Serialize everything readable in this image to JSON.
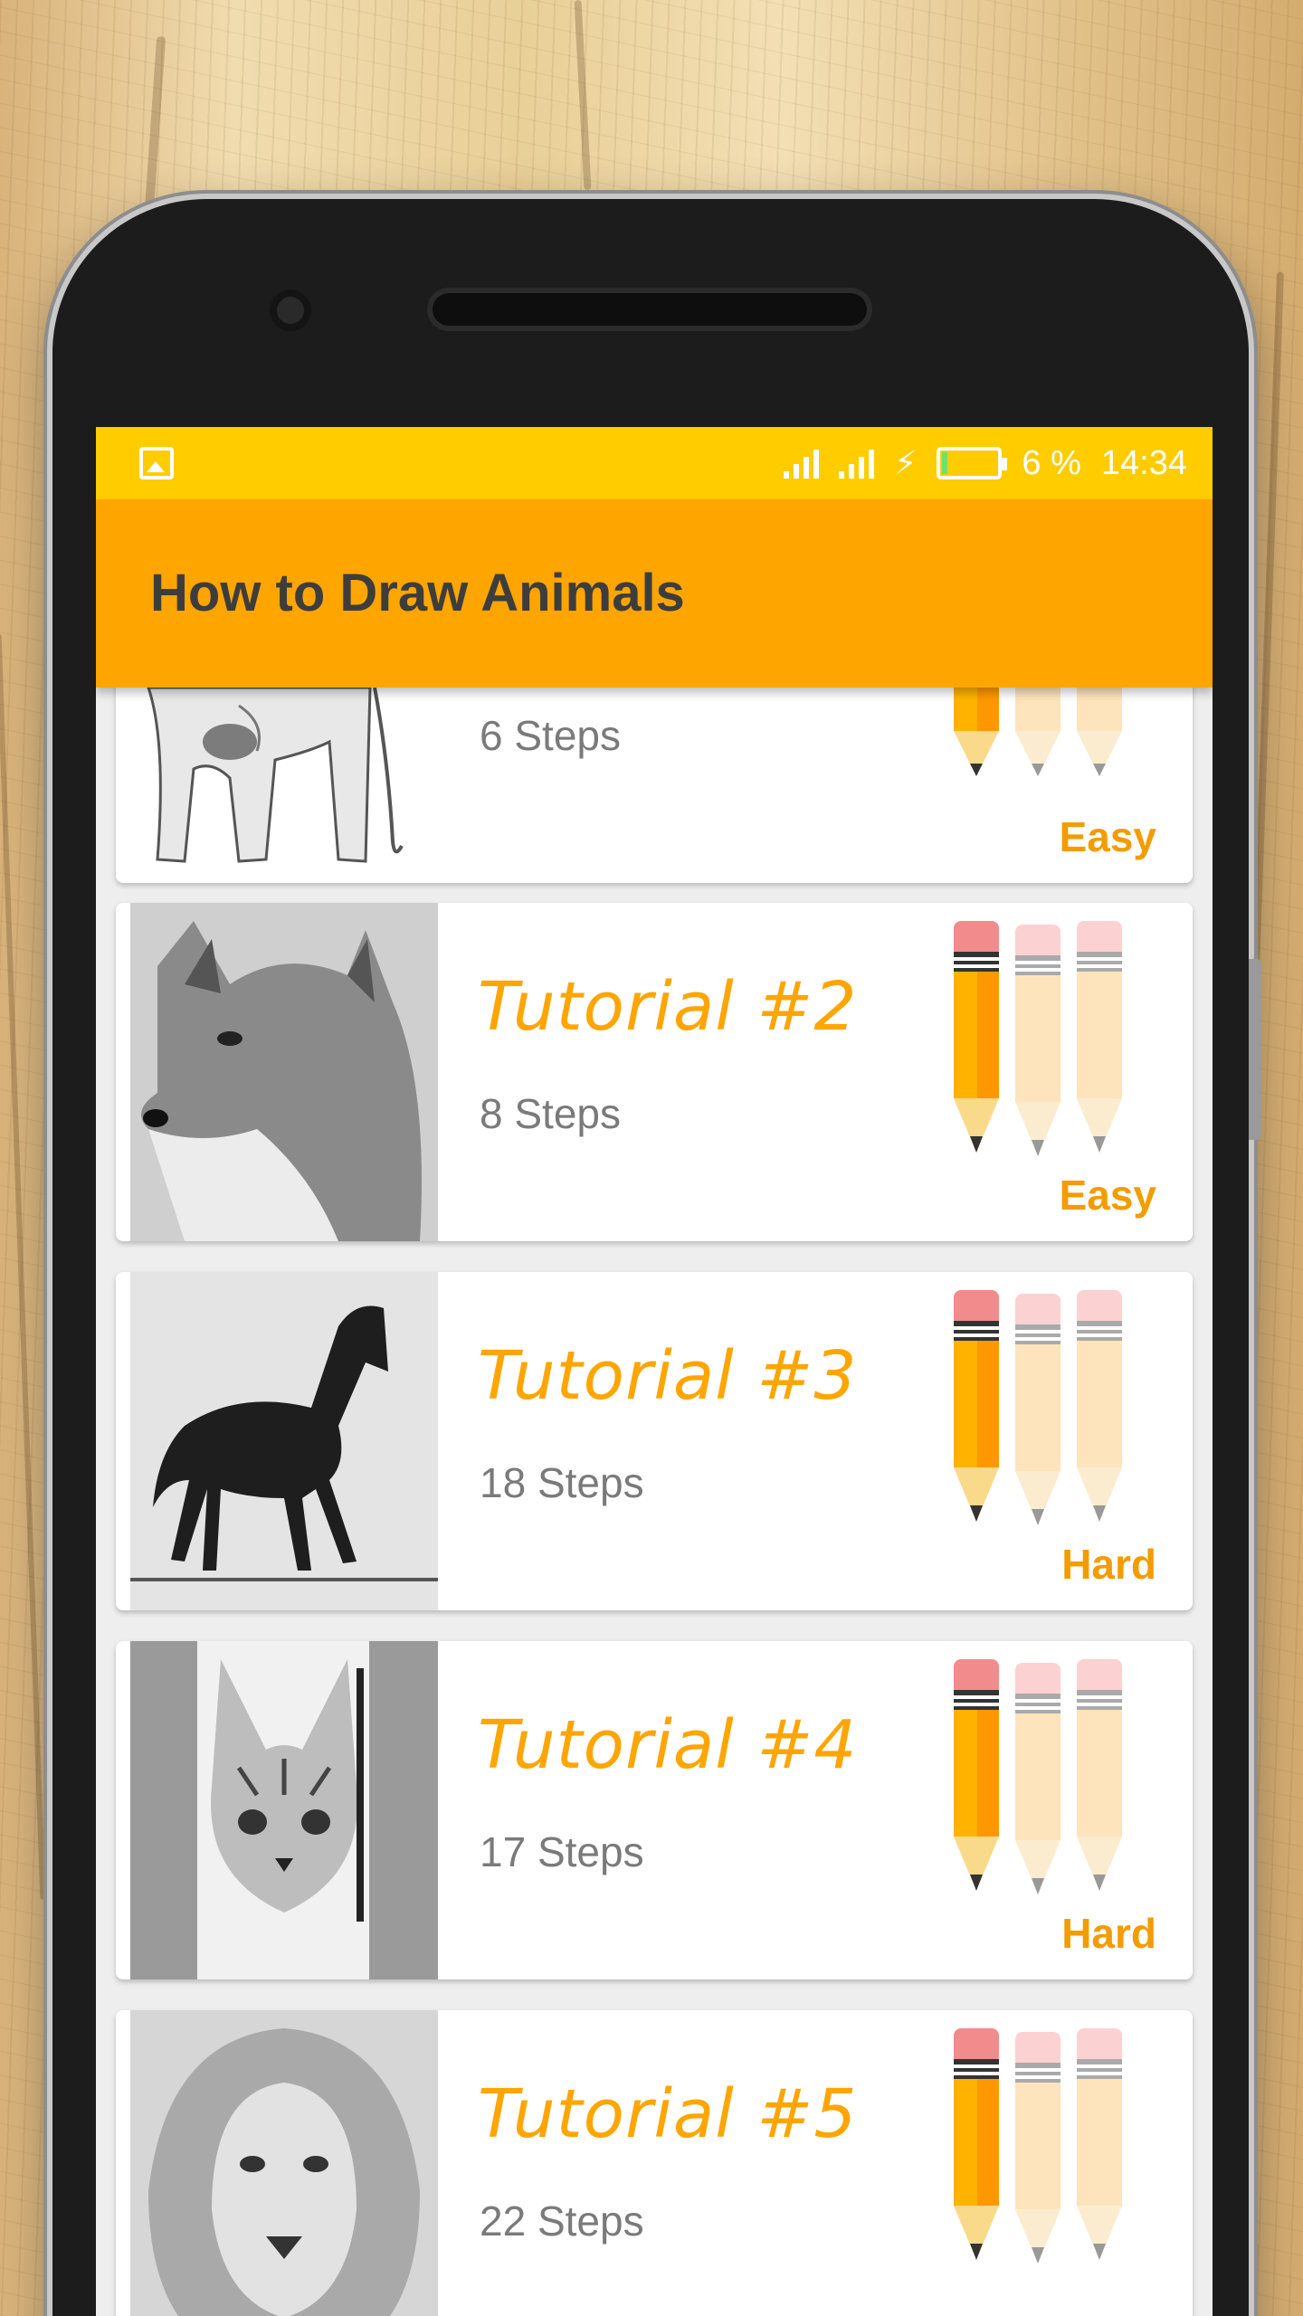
{
  "status_bar": {
    "battery_percent": "6 %",
    "time": "14:34",
    "battery_level": 0.06
  },
  "app_bar": {
    "title": "How to Draw Animals"
  },
  "tutorials": [
    {
      "title": "",
      "steps": "6 Steps",
      "difficulty": "Easy",
      "level": 1,
      "animal": "elephant"
    },
    {
      "title": "Tutorial #2",
      "steps": "8 Steps",
      "difficulty": "Easy",
      "level": 1,
      "animal": "wolf"
    },
    {
      "title": "Tutorial #3",
      "steps": "18 Steps",
      "difficulty": "Hard",
      "level": 1,
      "animal": "horse"
    },
    {
      "title": "Tutorial #4",
      "steps": "17 Steps",
      "difficulty": "Hard",
      "level": 1,
      "animal": "cat"
    },
    {
      "title": "Tutorial #5",
      "steps": "22 Steps",
      "difficulty": "",
      "level": 1,
      "animal": "lion"
    }
  ],
  "colors": {
    "status_bar": "#ffcc00",
    "app_bar": "#ffa500",
    "accent": "#ffa500",
    "difficulty": "#f39c00"
  }
}
